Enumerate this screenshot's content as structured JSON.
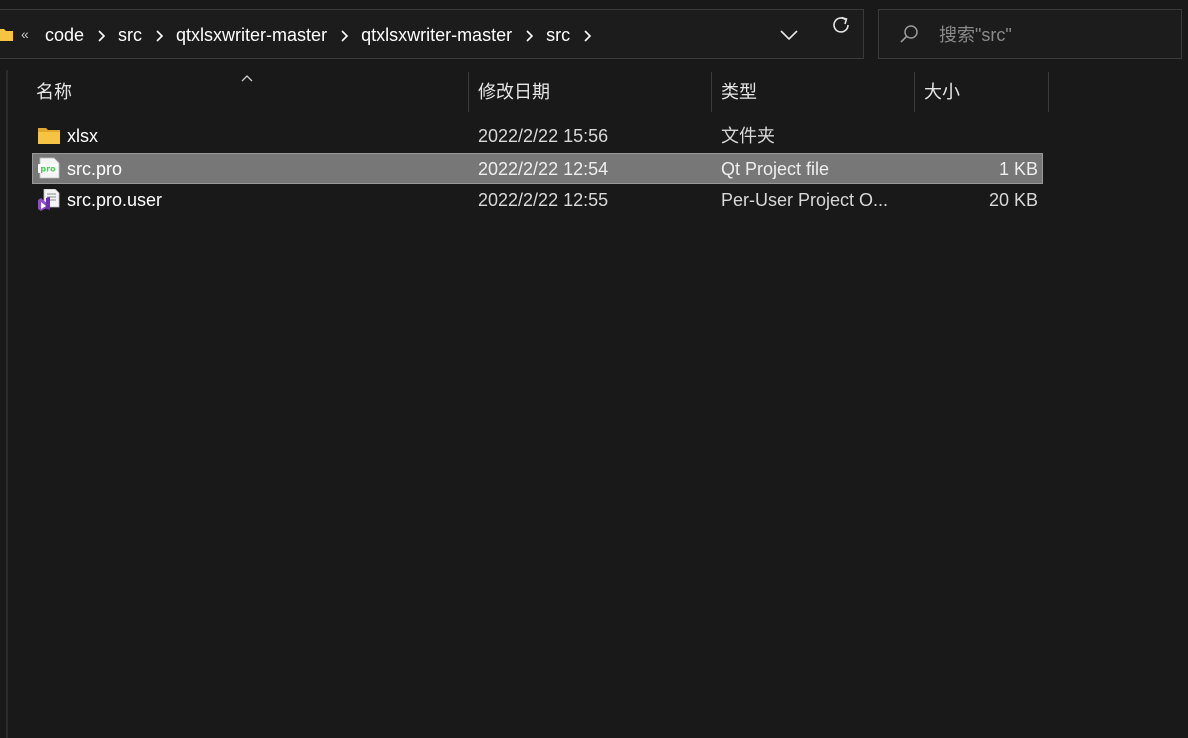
{
  "address_bar": {
    "overflow_label": "«",
    "crumbs": [
      "code",
      "src",
      "qtxlsxwriter-master",
      "qtxlsxwriter-master",
      "src"
    ]
  },
  "search": {
    "placeholder": "搜索\"src\""
  },
  "columns": {
    "name": "名称",
    "modified": "修改日期",
    "type": "类型",
    "size": "大小"
  },
  "files": [
    {
      "name": "xlsx",
      "modified": "2022/2/22 15:56",
      "type": "文件夹",
      "size": "",
      "icon": "folder-icon",
      "selected": false
    },
    {
      "name": "src.pro",
      "modified": "2022/2/22 12:54",
      "type": "Qt Project file",
      "size": "1 KB",
      "icon": "qt-pro-file-icon",
      "selected": true
    },
    {
      "name": "src.pro.user",
      "modified": "2022/2/22 12:55",
      "type": "Per-User Project O...",
      "size": "20 KB",
      "icon": "visual-studio-file-icon",
      "selected": false
    }
  ],
  "colors": {
    "background": "#191919",
    "selection": "#777777",
    "folder": "#f6c342",
    "qt_green": "#41cd52",
    "vs_purple": "#8a4fc7"
  }
}
